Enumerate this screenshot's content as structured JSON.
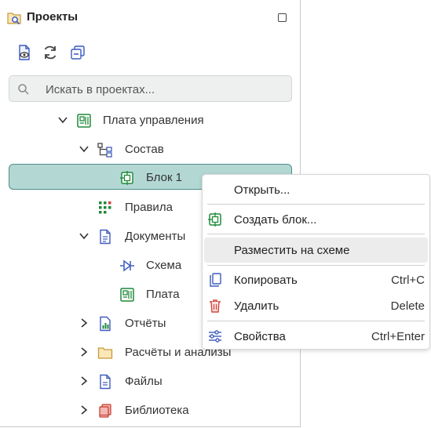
{
  "panel": {
    "title": "Проекты",
    "toolbar": {
      "buttons": [
        {
          "icon": "document-view-icon"
        },
        {
          "icon": "refresh-icon"
        },
        {
          "icon": "collapse-all-icon"
        }
      ]
    },
    "search": {
      "placeholder": "Искать в проектах..."
    }
  },
  "tree": [
    {
      "label": "Плата управления",
      "icon": "pcb-board-icon",
      "expanded": true,
      "level": 0
    },
    {
      "label": "Состав",
      "icon": "hierarchy-icon",
      "expanded": true,
      "level": 1
    },
    {
      "label": "Блок 1",
      "icon": "block-icon",
      "selected": true,
      "level": 2
    },
    {
      "label": "Правила",
      "icon": "rules-grid-icon",
      "level": 1
    },
    {
      "label": "Документы",
      "icon": "documents-icon",
      "expanded": true,
      "level": 1
    },
    {
      "label": "Схема",
      "icon": "schematic-icon",
      "level": 2
    },
    {
      "label": "Плата",
      "icon": "pcb-board-icon",
      "level": 2
    },
    {
      "label": "Отчёты",
      "icon": "report-chart-icon",
      "expanded": false,
      "level": 1
    },
    {
      "label": "Расчёты и анализы",
      "icon": "folder-icon",
      "expanded": false,
      "level": 1
    },
    {
      "label": "Файлы",
      "icon": "file-icon",
      "expanded": false,
      "level": 1
    },
    {
      "label": "Библиотека",
      "icon": "library-books-icon",
      "expanded": false,
      "level": 1
    }
  ],
  "context_menu": {
    "items": [
      {
        "label": "Открыть...",
        "shortcut": "",
        "icon": ""
      },
      {
        "label": "Создать блок...",
        "shortcut": "",
        "icon": "block-icon"
      },
      {
        "label": "Разместить на схеме",
        "shortcut": "",
        "icon": "",
        "hover": true
      },
      {
        "label": "Копировать",
        "shortcut": "Ctrl+C",
        "icon": "copy-icon"
      },
      {
        "label": "Удалить",
        "shortcut": "Delete",
        "icon": "trash-icon"
      },
      {
        "label": "Свойства",
        "shortcut": "Ctrl+Enter",
        "icon": "properties-sliders-icon"
      }
    ]
  },
  "colors": {
    "selection_bg": "#b3d8d4",
    "selection_border": "#4e8f89",
    "icon_blue": "#3f5bbf",
    "icon_green": "#1f8a3a",
    "icon_red": "#d0453a"
  }
}
